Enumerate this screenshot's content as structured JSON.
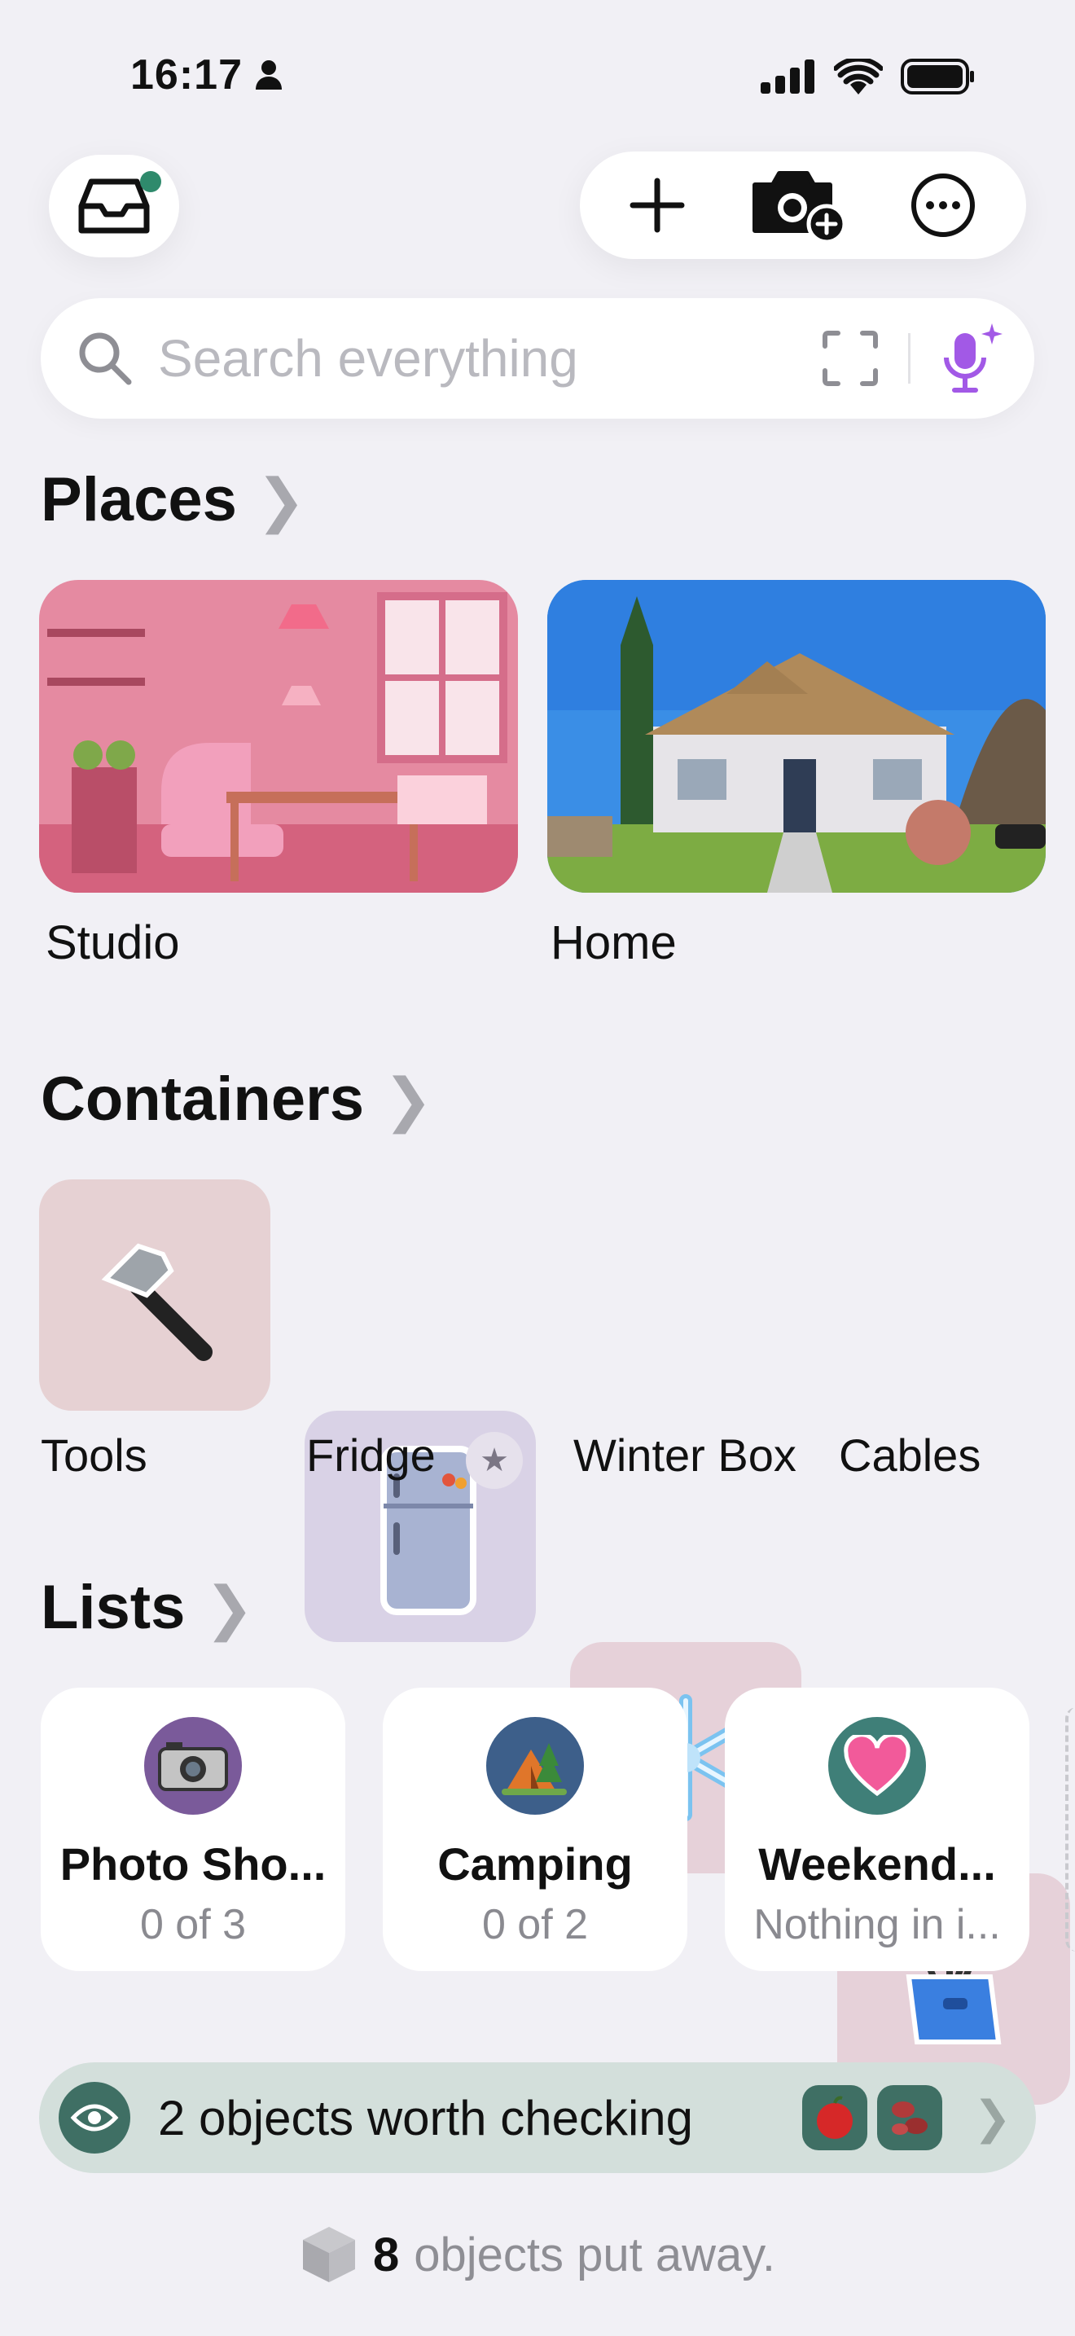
{
  "status_bar": {
    "time": "16:17"
  },
  "search": {
    "placeholder": "Search everything"
  },
  "sections": {
    "places": {
      "title": "Places",
      "items": [
        {
          "label": "Studio"
        },
        {
          "label": "Home"
        }
      ]
    },
    "containers": {
      "title": "Containers",
      "items": [
        {
          "label": "Tools",
          "icon": "hammer-icon",
          "color": "#e6d1d3"
        },
        {
          "label": "Fridge",
          "icon": "fridge-icon",
          "color": "#d9d2e6",
          "starred": true
        },
        {
          "label": "Winter Box",
          "icon": "snowflake-icon",
          "color": "#e6d1d9"
        },
        {
          "label": "Cables",
          "icon": "cable-box-icon",
          "color": "#e6d1d9"
        }
      ]
    },
    "lists": {
      "title": "Lists",
      "items": [
        {
          "title": "Photo Sho...",
          "subtitle": "0 of 3",
          "icon": "camera-icon",
          "color": "#7a5a9a"
        },
        {
          "title": "Camping",
          "subtitle": "0 of 2",
          "icon": "tent-icon",
          "color": "#3d5f8a"
        },
        {
          "title": "Weekend...",
          "subtitle": "Nothing in i...",
          "icon": "heart-icon",
          "color": "#3f7f78"
        }
      ]
    }
  },
  "check_bar": {
    "text": "2 objects worth checking"
  },
  "footer": {
    "count": "8",
    "text": "objects put away."
  },
  "colors": {
    "accent_green": "#3f6f64",
    "mic_purple": "#a259e6"
  }
}
